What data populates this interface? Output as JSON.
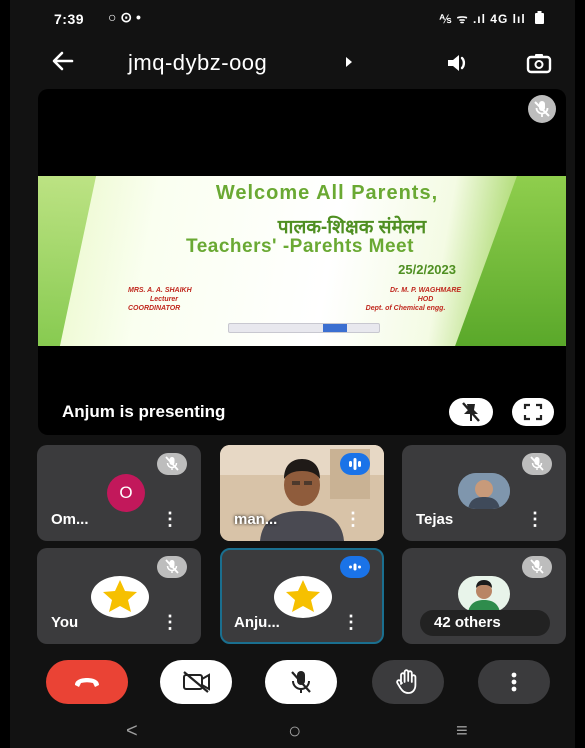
{
  "status_bar": {
    "time": "7:39",
    "left_icons": "○ ⊙ •",
    "right_icons": "⅍ ᯤ .ıl 4G lıl"
  },
  "header": {
    "meeting_code": "jmq-dybz-oog"
  },
  "presentation": {
    "presenting_label": "Anjum is presenting",
    "slide": {
      "line1": "Welcome All Parents,",
      "line2": "पालक-शिक्षक संमेलन",
      "line3": "Teachers' -Parehts Meet",
      "date": "25/2/2023",
      "left_sig": [
        "MRS. A. A. SHAIKH",
        "Lecturer",
        "COORDINATOR"
      ],
      "right_sig": [
        "Dr. M. P. WAGHMARE",
        "HOD",
        "Dept. of Chemical engg."
      ]
    }
  },
  "participants": [
    {
      "name": "Om...",
      "avatar": "O",
      "avatar_color": "#c2185b",
      "mic": "muted"
    },
    {
      "name": "man...",
      "avatar": "video",
      "mic": "speaking"
    },
    {
      "name": "Tejas",
      "avatar": "photo",
      "mic": "muted"
    },
    {
      "name": "You",
      "avatar": "star",
      "mic": "muted"
    },
    {
      "name": "Anju...",
      "avatar": "star",
      "mic": "speaking",
      "highlighted": true
    },
    {
      "name": "",
      "avatar": "photo",
      "mic": "muted"
    }
  ],
  "others": {
    "label": "42 others"
  },
  "controls": {
    "end_call_color": "#ea4335",
    "icons": [
      "end-call-icon",
      "camera-off-icon",
      "mic-off-icon",
      "raise-hand-icon",
      "more-options-icon"
    ]
  },
  "nav": {
    "back": "<",
    "home": "○",
    "recents": "≡"
  },
  "colors": {
    "accent_blue": "#1a73e8",
    "tile_bg": "#3b3b3d",
    "background": "#121212"
  }
}
